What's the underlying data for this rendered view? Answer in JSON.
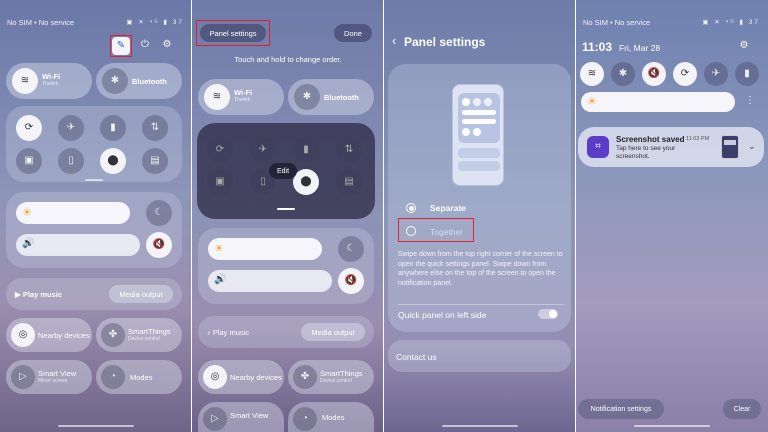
{
  "p1": {
    "status_left": "No SIM • No service",
    "status_right": "▣ ✕ ⁴ᴳ ▮ 37",
    "wifi": {
      "label": "Wi-Fi",
      "sub": "TheArk"
    },
    "bluetooth": "Bluetooth",
    "play_music": "Play music",
    "media_output": "Media output",
    "nearby": "Nearby devices",
    "smartthings": "SmartThings",
    "smartthings_sub": "Device control",
    "smartview": "Smart View",
    "smartview_sub": "Mirror screen",
    "modes": "Modes"
  },
  "p2": {
    "panel_settings": "Panel settings",
    "done": "Done",
    "hint": "Touch and hold to change order.",
    "wifi": {
      "label": "Wi-Fi",
      "sub": "TheArk"
    },
    "bluetooth": "Bluetooth",
    "edit": "Edit",
    "play_music": "Play music",
    "media_output": "Media output",
    "nearby": "Nearby devices",
    "smartthings": "SmartThings",
    "smartthings_sub": "Device control",
    "smartview": "Smart View",
    "modes": "Modes"
  },
  "p3": {
    "title": "Panel settings",
    "separate": "Separate",
    "together": "Together",
    "description": "Swipe down from the top right corner of the screen to open the quick settings panel. Swipe down from anywhere else on the top of the screen to open the notification panel.",
    "quick_left": "Quick panel on left side",
    "contact": "Contact us"
  },
  "p4": {
    "status_left": "No SIM • No service",
    "status_right": "▣ ✕ ⁴ᴳ ▮ 37",
    "time": "11:03",
    "date": "Fri, Mar 28",
    "notif_title": "Screenshot saved",
    "notif_time": "11:03 PM",
    "notif_body": "Tap here to see your screenshot.",
    "notif_settings": "Notification settings",
    "clear": "Clear"
  },
  "colors": {
    "highlight": "#e02030",
    "accent": "#f4a43a"
  }
}
